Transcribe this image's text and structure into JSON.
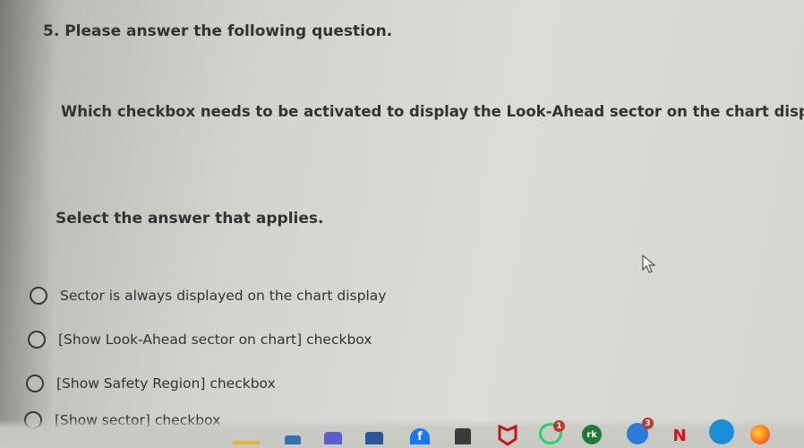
{
  "question": {
    "number_title": "5. Please answer the following question.",
    "text": "Which checkbox needs to be activated to display the Look-Ahead sector on the chart display?",
    "instruction": "Select the answer that applies."
  },
  "options": [
    {
      "label": "Sector is always displayed on the chart display",
      "selected": false
    },
    {
      "label": "[Show Look-Ahead sector on chart] checkbox",
      "selected": false
    },
    {
      "label": "[Show Safety Region] checkbox",
      "selected": false
    },
    {
      "label": "[Show sector] checkbox",
      "selected": false
    }
  ],
  "taskbar": {
    "icons": [
      {
        "name": "file-explorer-icon",
        "color": "#e8b23a"
      },
      {
        "name": "store-icon",
        "color": "#3a6fb0"
      },
      {
        "name": "teams-icon",
        "color": "#5b5fc7"
      },
      {
        "name": "word-icon",
        "color": "#2b5797"
      },
      {
        "name": "facebook-icon",
        "color": "#1877f2"
      },
      {
        "name": "calculator-icon",
        "color": "#3b3b3b"
      },
      {
        "name": "mcafee-icon",
        "color": "#c01818"
      },
      {
        "name": "whatsapp-icon",
        "color": "#25d366"
      },
      {
        "name": "rk-app-icon",
        "color": "#1f7a3a"
      },
      {
        "name": "chat-app-icon",
        "color": "#2b7bd8"
      },
      {
        "name": "netflix-icon",
        "color": "#e50914"
      },
      {
        "name": "edge-icon",
        "color": "#1a8fd8"
      },
      {
        "name": "firefox-icon",
        "color": "#ff7a1a"
      }
    ],
    "whatsapp_badge": "1",
    "chat_badge": "3"
  }
}
